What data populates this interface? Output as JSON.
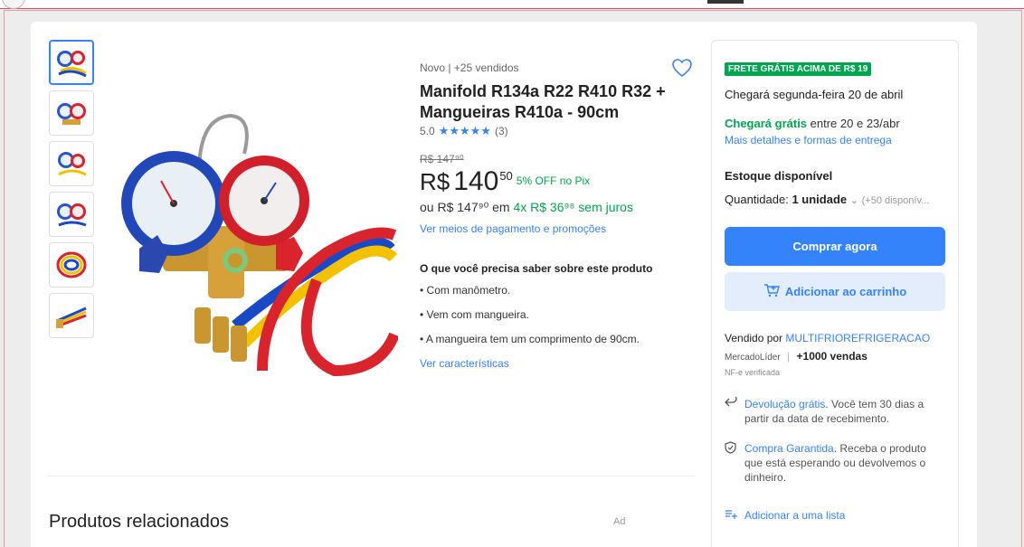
{
  "product": {
    "condition": "Novo | +25 vendidos",
    "title": "Manifold R134a R22 R410 R32 + Mangueiras R410a - 90cm",
    "rating": "5.0",
    "stars": "★★★★★",
    "reviews": "(3)",
    "old_price": "R$ 147⁹⁰",
    "price_currency": "R$",
    "price_int": "140",
    "price_cents": "50",
    "discount": "5% OFF no Pix",
    "installments_prefix": "ou R$ 147⁹⁰ em ",
    "installments_green": "4x R$ 36⁹⁸ sem juros",
    "payment_link": "Ver meios de pagamento e promoções",
    "know_title": "O que você precisa saber sobre este produto",
    "bullets": [
      "• Com manômetro.",
      "• Vem com mangueira.",
      "• A mangueira tem um comprimento de 90cm."
    ],
    "chars_link": "Ver características"
  },
  "sidebar": {
    "badge": "FRETE GRÁTIS ACIMA DE R$ 19",
    "arrival": "Chegará segunda-feira 20 de abril",
    "free_green": "Chegará grátis",
    "free_rest": " entre 20 e 23/abr",
    "more_link": "Mais detalhes e formas de entrega",
    "stock": "Estoque disponível",
    "qty_label": "Quantidade: ",
    "qty_value": "1 unidade",
    "qty_avail": "(+50 disponív...",
    "buy_button": "Comprar agora",
    "cart_button": "Adicionar ao carrinho",
    "seller_prefix": "Vendido por ",
    "seller_name": "MULTIFRIOREFRIGERACAO",
    "lider": "MercadoLíder",
    "sales": "+1000 vendas",
    "nfe": "NF-e verificada",
    "return_link": "Devolução grátis",
    "return_text": ". Você tem 30 dias a partir da data de recebimento.",
    "guarantee_link": "Compra Garantida",
    "guarantee_text": ". Receba o produto que está esperando ou devolvemos o dinheiro.",
    "list_link": "Adicionar a uma lista"
  },
  "related": {
    "title": "Produtos relacionados",
    "ad": "Ad"
  },
  "icons": [
    "heart-icon",
    "cart-icon",
    "return-icon",
    "shield-icon",
    "list-add-icon",
    "chevron-down-icon"
  ]
}
